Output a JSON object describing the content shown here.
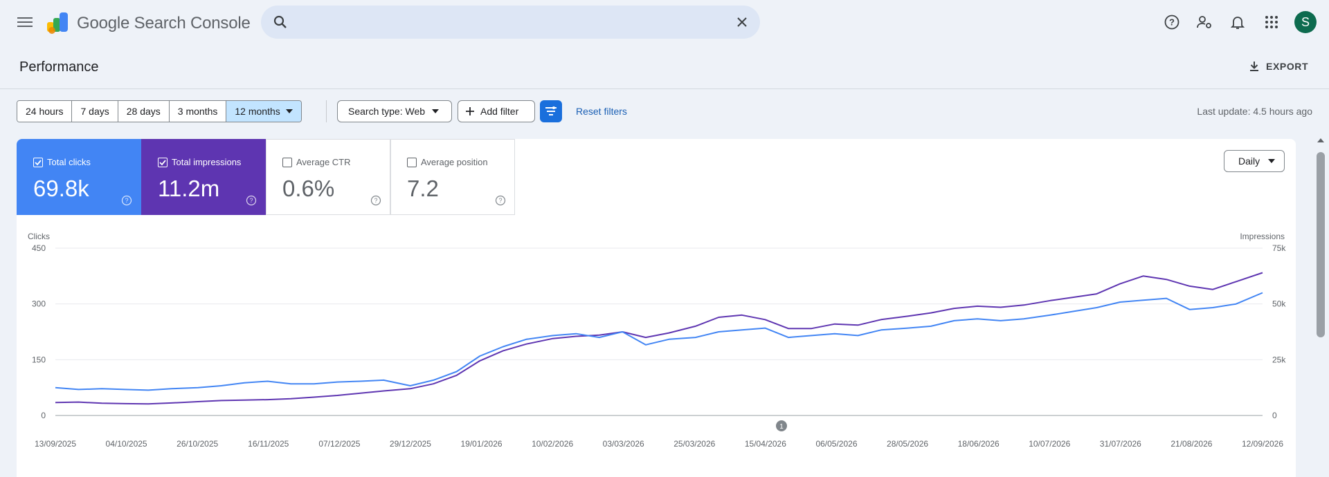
{
  "header": {
    "app_title": "Google Search Console",
    "search_placeholder": "",
    "avatar_letter": "S",
    "icons": [
      "menu-icon",
      "help-icon",
      "manage-users-icon",
      "notifications-icon",
      "apps-icon"
    ]
  },
  "page": {
    "title": "Performance",
    "export_label": "EXPORT"
  },
  "filters": {
    "ranges": [
      "24 hours",
      "7 days",
      "28 days",
      "3 months",
      "12 months"
    ],
    "selected_range": "12 months",
    "search_type": "Search type: Web",
    "add_filter": "Add filter",
    "reset": "Reset filters",
    "last_update": "Last update: 4.5 hours ago"
  },
  "metrics": [
    {
      "label": "Total clicks",
      "value": "69.8k",
      "checked": true,
      "color": "#4285f4"
    },
    {
      "label": "Total impressions",
      "value": "11.2m",
      "checked": true,
      "color": "#5e35b1"
    },
    {
      "label": "Average CTR",
      "value": "0.6%",
      "checked": false
    },
    {
      "label": "Average position",
      "value": "7.2",
      "checked": false
    }
  ],
  "granularity": "Daily",
  "annotation_badge": "1",
  "chart_data": {
    "type": "line",
    "ylabel": "Clicks",
    "y2label": "Impressions",
    "ylim": [
      0,
      450
    ],
    "y2lim": [
      0,
      75000
    ],
    "yticks": [
      "450",
      "300",
      "150",
      "0"
    ],
    "y2ticks": [
      "75k",
      "50k",
      "25k",
      "0"
    ],
    "x_tick_labels": [
      "13/09/2025",
      "04/10/2025",
      "26/10/2025",
      "16/11/2025",
      "07/12/2025",
      "29/12/2025",
      "19/01/2026",
      "10/02/2026",
      "03/03/2026",
      "25/03/2026",
      "15/04/2026",
      "06/05/2026",
      "28/05/2026",
      "18/06/2026",
      "10/07/2026",
      "31/07/2026",
      "21/08/2026",
      "12/09/2026"
    ],
    "grid": true,
    "series": [
      {
        "name": "Clicks",
        "color": "#4285f4",
        "axis": "left",
        "x": [
          "2025-09-13",
          "2025-09-20",
          "2025-09-27",
          "2025-10-04",
          "2025-10-11",
          "2025-10-18",
          "2025-10-26",
          "2025-11-02",
          "2025-11-09",
          "2025-11-16",
          "2025-11-23",
          "2025-11-30",
          "2025-12-07",
          "2025-12-14",
          "2025-12-21",
          "2025-12-29",
          "2026-01-05",
          "2026-01-12",
          "2026-01-19",
          "2026-01-26",
          "2026-02-02",
          "2026-02-10",
          "2026-02-17",
          "2026-02-24",
          "2026-03-03",
          "2026-03-10",
          "2026-03-17",
          "2026-03-25",
          "2026-04-01",
          "2026-04-08",
          "2026-04-15",
          "2026-04-22",
          "2026-04-29",
          "2026-05-06",
          "2026-05-13",
          "2026-05-20",
          "2026-05-28",
          "2026-06-04",
          "2026-06-11",
          "2026-06-18",
          "2026-06-25",
          "2026-07-02",
          "2026-07-10",
          "2026-07-17",
          "2026-07-24",
          "2026-07-31",
          "2026-08-07",
          "2026-08-14",
          "2026-08-21",
          "2026-08-28",
          "2026-09-04",
          "2026-09-12"
        ],
        "values": [
          75,
          70,
          72,
          70,
          68,
          72,
          75,
          80,
          88,
          92,
          85,
          85,
          90,
          92,
          95,
          80,
          95,
          118,
          160,
          185,
          205,
          215,
          220,
          210,
          225,
          190,
          205,
          210,
          225,
          230,
          235,
          210,
          215,
          220,
          215,
          230,
          235,
          240,
          255,
          260,
          255,
          260,
          270,
          280,
          290,
          305,
          310,
          315,
          285,
          290,
          300,
          330
        ]
      },
      {
        "name": "Impressions",
        "color": "#5e35b1",
        "axis": "right",
        "x": [
          "2025-09-13",
          "2025-09-20",
          "2025-09-27",
          "2025-10-04",
          "2025-10-11",
          "2025-10-18",
          "2025-10-26",
          "2025-11-02",
          "2025-11-09",
          "2025-11-16",
          "2025-11-23",
          "2025-11-30",
          "2025-12-07",
          "2025-12-14",
          "2025-12-21",
          "2025-12-29",
          "2026-01-05",
          "2026-01-12",
          "2026-01-19",
          "2026-01-26",
          "2026-02-02",
          "2026-02-10",
          "2026-02-17",
          "2026-02-24",
          "2026-03-03",
          "2026-03-10",
          "2026-03-17",
          "2026-03-25",
          "2026-04-01",
          "2026-04-08",
          "2026-04-15",
          "2026-04-22",
          "2026-04-29",
          "2026-05-06",
          "2026-05-13",
          "2026-05-20",
          "2026-05-28",
          "2026-06-04",
          "2026-06-11",
          "2026-06-18",
          "2026-06-25",
          "2026-07-02",
          "2026-07-10",
          "2026-07-17",
          "2026-07-24",
          "2026-07-31",
          "2026-08-07",
          "2026-08-14",
          "2026-08-21",
          "2026-08-28",
          "2026-09-04",
          "2026-09-12"
        ],
        "values": [
          5800,
          6000,
          5500,
          5300,
          5200,
          5600,
          6200,
          6700,
          6900,
          7100,
          7500,
          8200,
          9000,
          10000,
          11000,
          12000,
          14200,
          18000,
          24500,
          29000,
          32000,
          34500,
          35500,
          36000,
          37500,
          35000,
          37000,
          40000,
          44000,
          45000,
          43000,
          39000,
          39000,
          41000,
          40500,
          43000,
          44500,
          46000,
          48000,
          49000,
          48500,
          49500,
          51500,
          53000,
          54500,
          59000,
          62500,
          61000,
          58000,
          56500,
          60000,
          64000
        ]
      }
    ]
  }
}
